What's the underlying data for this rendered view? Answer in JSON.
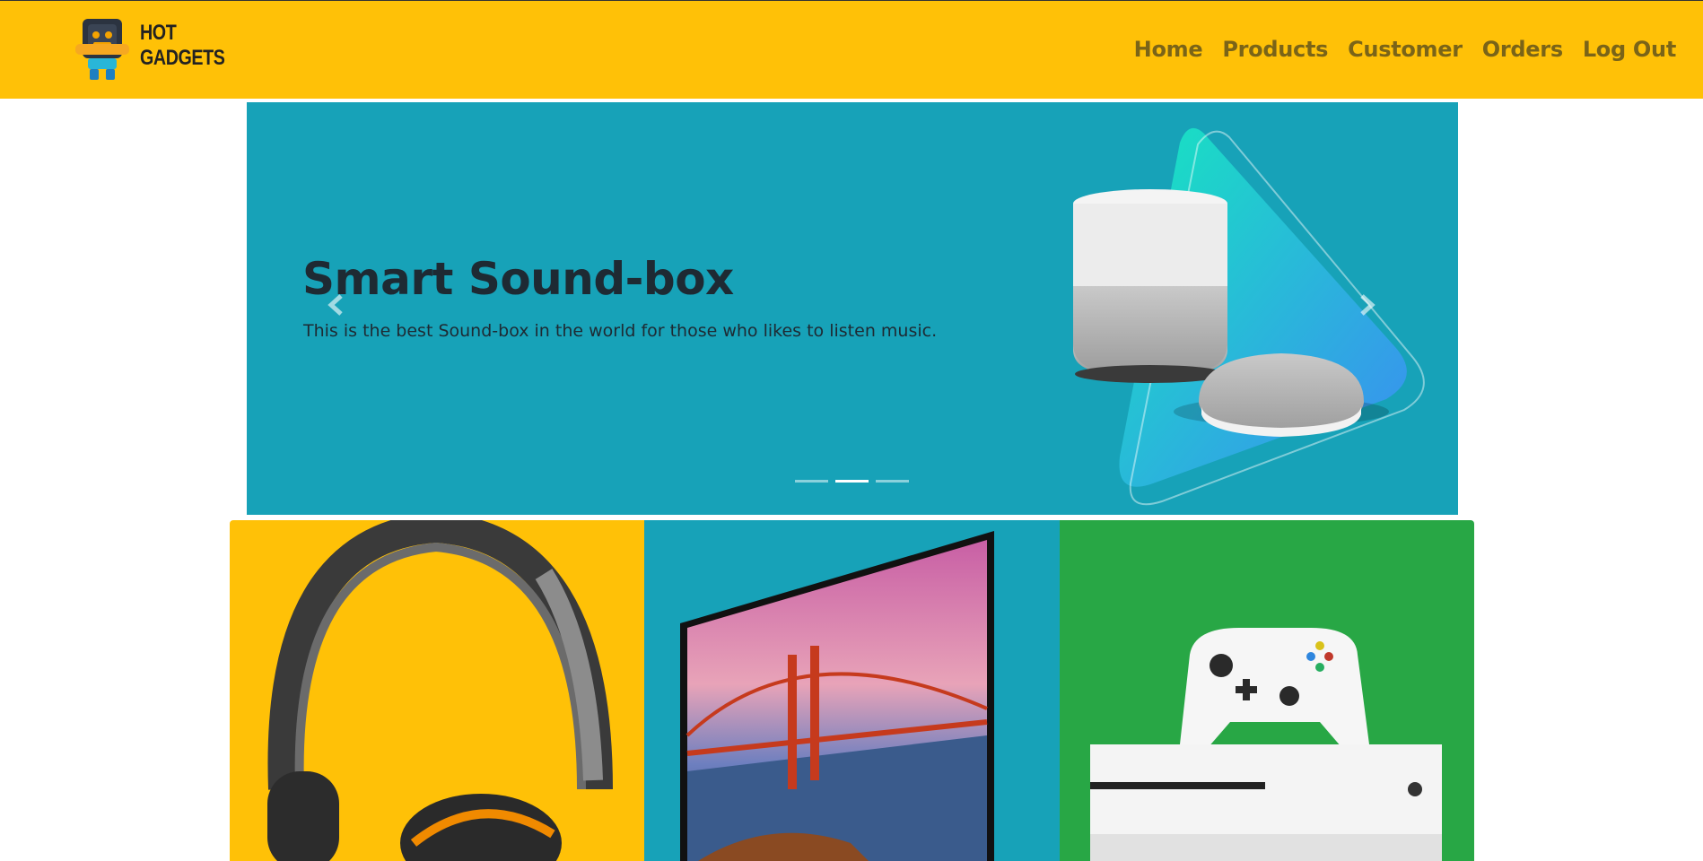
{
  "brand": {
    "line1": "HOT",
    "line2": "GADGETS"
  },
  "nav": [
    "Home",
    "Products",
    "Customer",
    "Orders",
    "Log Out"
  ],
  "carousel": {
    "title": "Smart Sound-box",
    "text": "This is the best Sound-box in the world for those who likes to listen music.",
    "prev_icon": "chevron-left-icon",
    "next_icon": "chevron-right-icon",
    "slide_count": 3,
    "active_slide": 2
  },
  "cards": [
    {
      "color": "#ffc107",
      "image": "headphones"
    },
    {
      "color": "#17a2b8",
      "image": "television"
    },
    {
      "color": "#28a745",
      "image": "game-console"
    }
  ],
  "colors": {
    "navbar": "#ffc107",
    "carousel": "#17a2b8",
    "nav_link": "#7a6418"
  }
}
